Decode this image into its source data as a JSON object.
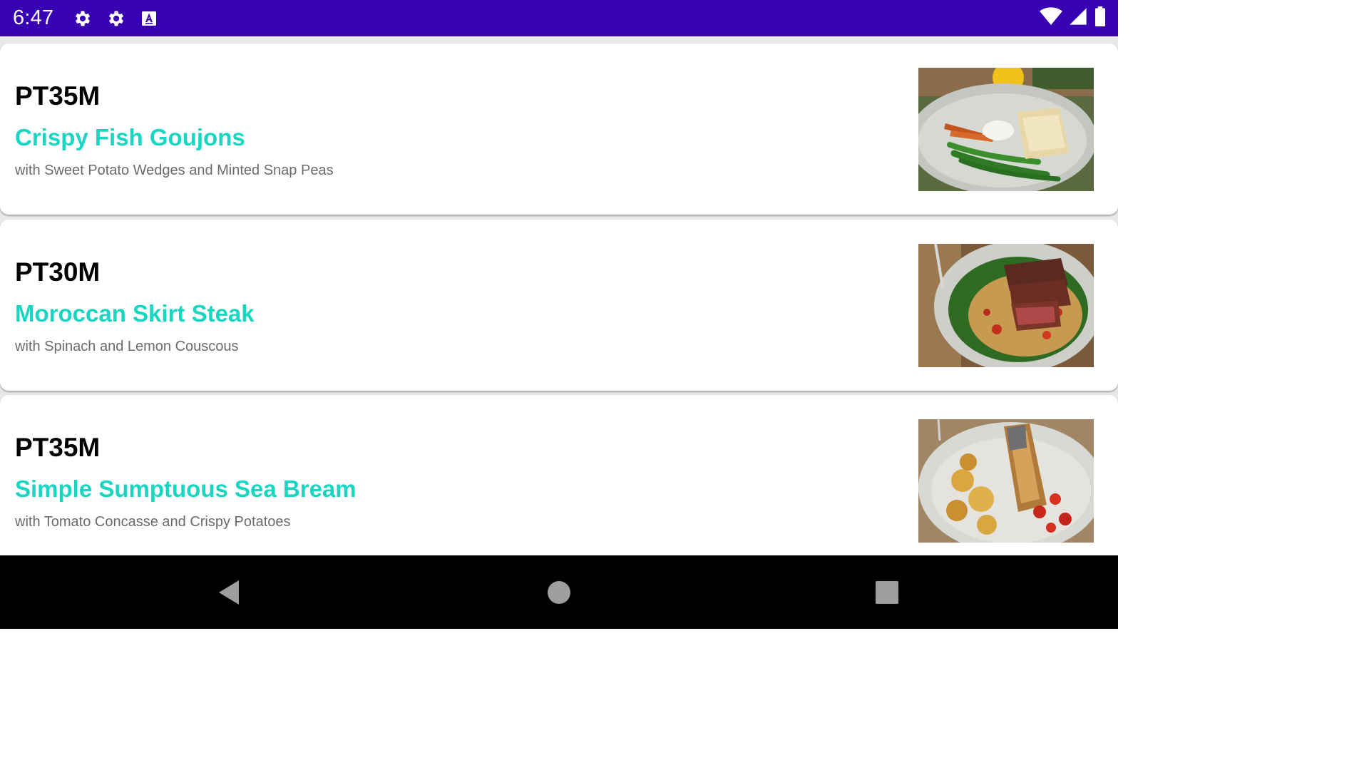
{
  "status_bar": {
    "time": "6:47",
    "background_color": "#3700b3",
    "left_icons": [
      "settings-gear-icon",
      "settings-gear-icon",
      "text-a-icon"
    ],
    "right_icons": [
      "wifi-icon",
      "signal-icon",
      "battery-icon"
    ]
  },
  "theme": {
    "title_color": "#18d6c2",
    "duration_color": "#000000",
    "subtitle_color": "#6b6b6b"
  },
  "recipes": [
    {
      "duration": "PT35M",
      "title": "Crispy Fish Goujons",
      "subtitle": "with Sweet Potato Wedges and Minted Snap Peas",
      "image": "fish-goujons-plate-photo"
    },
    {
      "duration": "PT30M",
      "title": "Moroccan Skirt Steak",
      "subtitle": "with Spinach and Lemon Couscous",
      "image": "skirt-steak-couscous-photo"
    },
    {
      "duration": "PT35M",
      "title": "Simple Sumptuous Sea Bream",
      "subtitle": "with Tomato Concasse and Crispy Potatoes",
      "image": "sea-bream-potatoes-photo"
    }
  ],
  "nav_bar": {
    "buttons": [
      "back-icon",
      "home-icon",
      "recents-icon"
    ]
  }
}
